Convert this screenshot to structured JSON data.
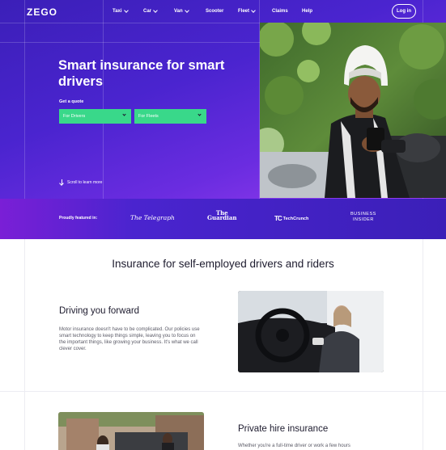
{
  "brand": {
    "logo": "ZEGO"
  },
  "nav": {
    "items": [
      {
        "label": "Taxi",
        "has_dropdown": true
      },
      {
        "label": "Car",
        "has_dropdown": true
      },
      {
        "label": "Van",
        "has_dropdown": true
      },
      {
        "label": "Scooter",
        "has_dropdown": false
      },
      {
        "label": "Fleet",
        "has_dropdown": true
      },
      {
        "label": "Claims",
        "has_dropdown": false
      },
      {
        "label": "Help",
        "has_dropdown": false
      }
    ],
    "login_label": "Log in"
  },
  "hero": {
    "headline": "Smart insurance for smart drivers",
    "quote_label": "Get a quote",
    "dropdowns": [
      {
        "value": "For Drivers"
      },
      {
        "value": "For Fleets"
      }
    ],
    "scroll_hint": "Scroll to learn more"
  },
  "featured": {
    "label": "Proudly featured in:",
    "outlets": [
      {
        "name": "The Telegraph"
      },
      {
        "name": "The Guardian"
      },
      {
        "name": "TechCrunch"
      },
      {
        "name": "BUSINESS INSIDER"
      }
    ]
  },
  "main": {
    "section_title": "Insurance for self-employed drivers and riders",
    "cards": [
      {
        "title": "Driving you forward",
        "body": "Motor insurance doesn't have to be complicated. Our policies use smart technology to keep things simple, leaving you to focus on the important things, like growing your business. It's what we call clever cover."
      },
      {
        "title": "Private hire insurance",
        "body": "Whether you're a full-time driver or work a few hours"
      }
    ]
  },
  "colors": {
    "hero_start": "#3b1fb8",
    "hero_end": "#9a3ef0",
    "accent_green": "#39d88a",
    "text_dark": "#1d1b2e"
  }
}
